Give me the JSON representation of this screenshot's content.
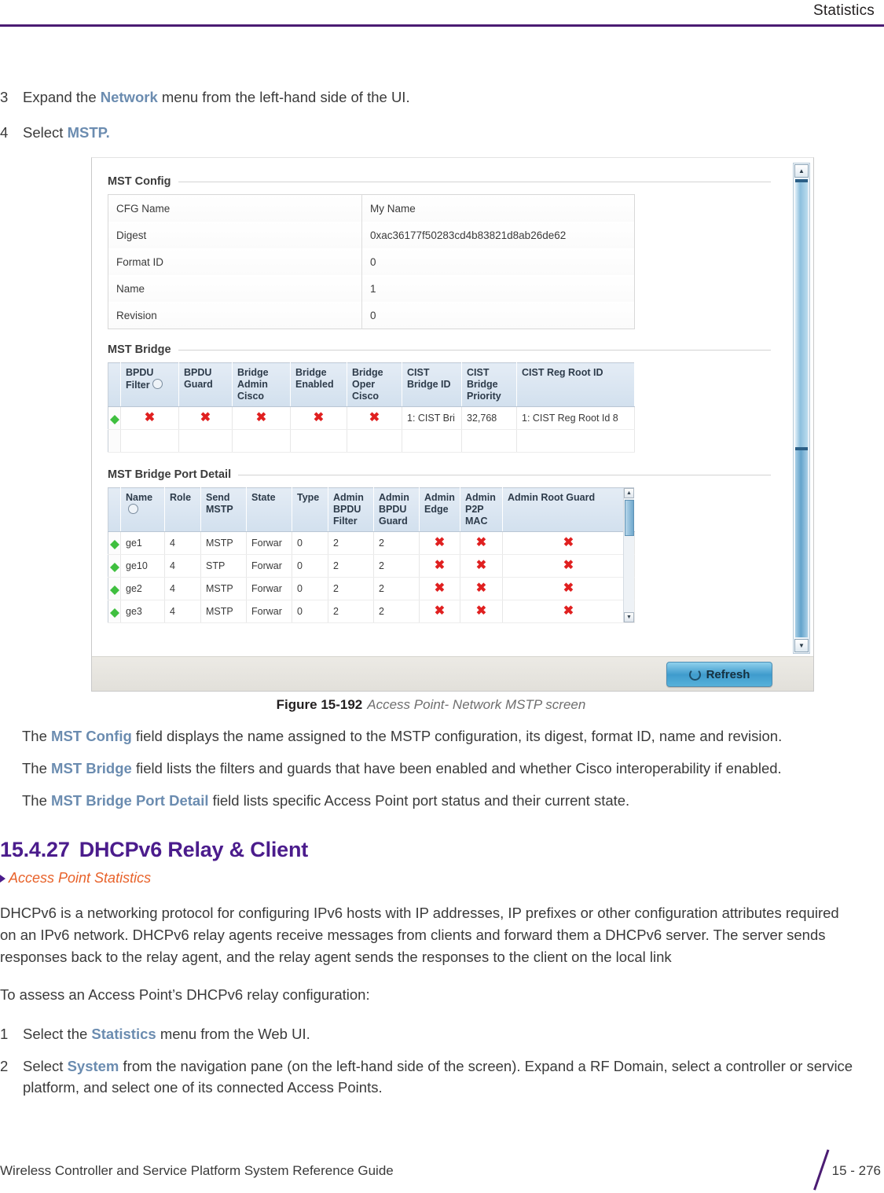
{
  "header": {
    "title": "Statistics"
  },
  "steps_top": [
    {
      "num": "3",
      "pre": "Expand the ",
      "kw": "Network",
      "post": " menu from the left-hand side of the UI."
    },
    {
      "num": "4",
      "pre": "Select ",
      "kw": "MSTP.",
      "post": ""
    }
  ],
  "screenshot": {
    "mst_config": {
      "legend": "MST Config",
      "rows": [
        {
          "key": "CFG Name",
          "value": "My Name"
        },
        {
          "key": "Digest",
          "value": "0xac36177f50283cd4b83821d8ab26de62"
        },
        {
          "key": "Format ID",
          "value": "0"
        },
        {
          "key": "Name",
          "value": "1"
        },
        {
          "key": "Revision",
          "value": "0"
        }
      ]
    },
    "mst_bridge": {
      "legend": "MST Bridge",
      "columns": [
        "BPDU Filter",
        "BPDU Guard",
        "Bridge Admin Cisco",
        "Bridge Enabled",
        "Bridge Oper Cisco",
        "CIST Bridge ID",
        "CIST Bridge Priority",
        "CIST Reg Root ID"
      ],
      "rows": [
        {
          "bpdu_filter": "✖",
          "bpdu_guard": "✖",
          "bridge_admin_cisco": "✖",
          "bridge_enabled": "✖",
          "bridge_oper_cisco": "✖",
          "cist_bridge_id": "1: CIST Bri",
          "cist_bridge_priority": "32,768",
          "cist_reg_root_id": "1: CIST Reg Root Id 8"
        }
      ]
    },
    "mst_bridge_port_detail": {
      "legend": "MST Bridge Port Detail",
      "columns": [
        "Name",
        "Role",
        "Send MSTP",
        "State",
        "Type",
        "Admin BPDU Filter",
        "Admin BPDU Guard",
        "Admin Edge",
        "Admin P2P MAC",
        "Admin Root Guard"
      ],
      "rows": [
        {
          "name": "ge1",
          "role": "4",
          "send_mstp": "MSTP",
          "state": "Forwar",
          "type": "0",
          "admin_bpdu_filter": "2",
          "admin_bpdu_guard": "2",
          "admin_edge": "✖",
          "admin_p2p_mac": "✖",
          "admin_root_guard": "✖"
        },
        {
          "name": "ge10",
          "role": "4",
          "send_mstp": "STP",
          "state": "Forwar",
          "type": "0",
          "admin_bpdu_filter": "2",
          "admin_bpdu_guard": "2",
          "admin_edge": "✖",
          "admin_p2p_mac": "✖",
          "admin_root_guard": "✖"
        },
        {
          "name": "ge2",
          "role": "4",
          "send_mstp": "MSTP",
          "state": "Forwar",
          "type": "0",
          "admin_bpdu_filter": "2",
          "admin_bpdu_guard": "2",
          "admin_edge": "✖",
          "admin_p2p_mac": "✖",
          "admin_root_guard": "✖"
        },
        {
          "name": "ge3",
          "role": "4",
          "send_mstp": "MSTP",
          "state": "Forwar",
          "type": "0",
          "admin_bpdu_filter": "2",
          "admin_bpdu_guard": "2",
          "admin_edge": "✖",
          "admin_p2p_mac": "✖",
          "admin_root_guard": "✖"
        }
      ]
    },
    "refresh_label": "Refresh"
  },
  "caption": {
    "number": "Figure 15-192",
    "text": "Access Point- Network MSTP screen"
  },
  "descriptions": [
    {
      "pre": "The ",
      "kw": "MST Config",
      "post": " field displays the name assigned to the MSTP configuration, its digest, format ID, name and revision."
    },
    {
      "pre": "The ",
      "kw": "MST Bridge",
      "post": " field lists the filters and guards that have been enabled and whether Cisco interoperability if enabled."
    },
    {
      "pre": "The ",
      "kw": "MST Bridge Port Detail",
      "post": " field lists specific Access Point port status and their current state."
    }
  ],
  "section": {
    "number": "15.4.27",
    "title": "DHCPv6 Relay & Client",
    "xref": "Access Point Statistics"
  },
  "paragraphs": [
    "DHCPv6 is a networking protocol for configuring IPv6 hosts with IP addresses, IP prefixes or other configuration attributes required on an IPv6 network. DHCPv6 relay agents receive messages from clients and forward them a DHCPv6 server. The server sends responses back to the relay agent, and the relay agent sends the responses to the client on the local link",
    "To assess an Access Point’s DHCPv6 relay configuration:"
  ],
  "steps_bottom": [
    {
      "num": "1",
      "pre": "Select the ",
      "kw": "Statistics",
      "post": " menu from the Web UI."
    },
    {
      "num": "2",
      "pre": "Select ",
      "kw": "System",
      "post": " from the navigation pane (on the left-hand side of the screen). Expand a RF Domain, select a controller or service platform, and select one of its connected Access Points."
    }
  ],
  "footer": {
    "guide": "Wireless Controller and Service Platform System Reference Guide",
    "page": "15 - 276"
  }
}
